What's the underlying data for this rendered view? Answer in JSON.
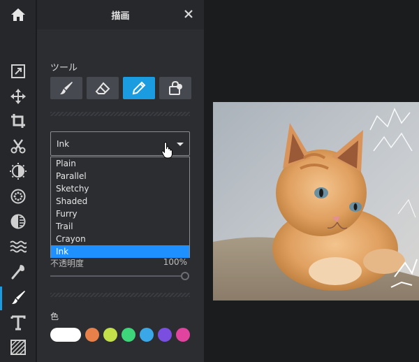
{
  "panel": {
    "title": "描画",
    "tools_label": "ツール",
    "sub_tools": [
      {
        "icon": "brush-icon",
        "active": false
      },
      {
        "icon": "eraser-icon",
        "active": false
      },
      {
        "icon": "pen-icon",
        "active": true
      },
      {
        "icon": "fill-bucket-icon",
        "active": false
      }
    ],
    "brush_select": {
      "value": "Ink",
      "options": [
        "Plain",
        "Parallel",
        "Sketchy",
        "Shaded",
        "Furry",
        "Trail",
        "Crayon",
        "Ink"
      ],
      "selected": "Ink"
    },
    "opacity": {
      "label": "不透明度",
      "value": "100%",
      "level": 1.0
    },
    "color_label": "色",
    "colors": [
      "#ffffff",
      "#e8804a",
      "#c3e04a",
      "#3ed67a",
      "#3aa8e8",
      "#7a4fe0",
      "#e0449e"
    ]
  },
  "toolbar": {
    "items": [
      "home-icon",
      "export-icon",
      "move-icon",
      "crop-icon",
      "cut-icon",
      "adjust-icon",
      "filter-icon",
      "overlay-icon",
      "liquify-icon",
      "retouch-icon",
      "draw-icon",
      "text-icon",
      "texture-icon"
    ],
    "active": "draw-icon"
  },
  "colors": {
    "accent": "#1b9be0",
    "panel_bg": "#2b2d31",
    "toolbar_bg": "#25272b",
    "selected_item": "#1e90ff"
  }
}
